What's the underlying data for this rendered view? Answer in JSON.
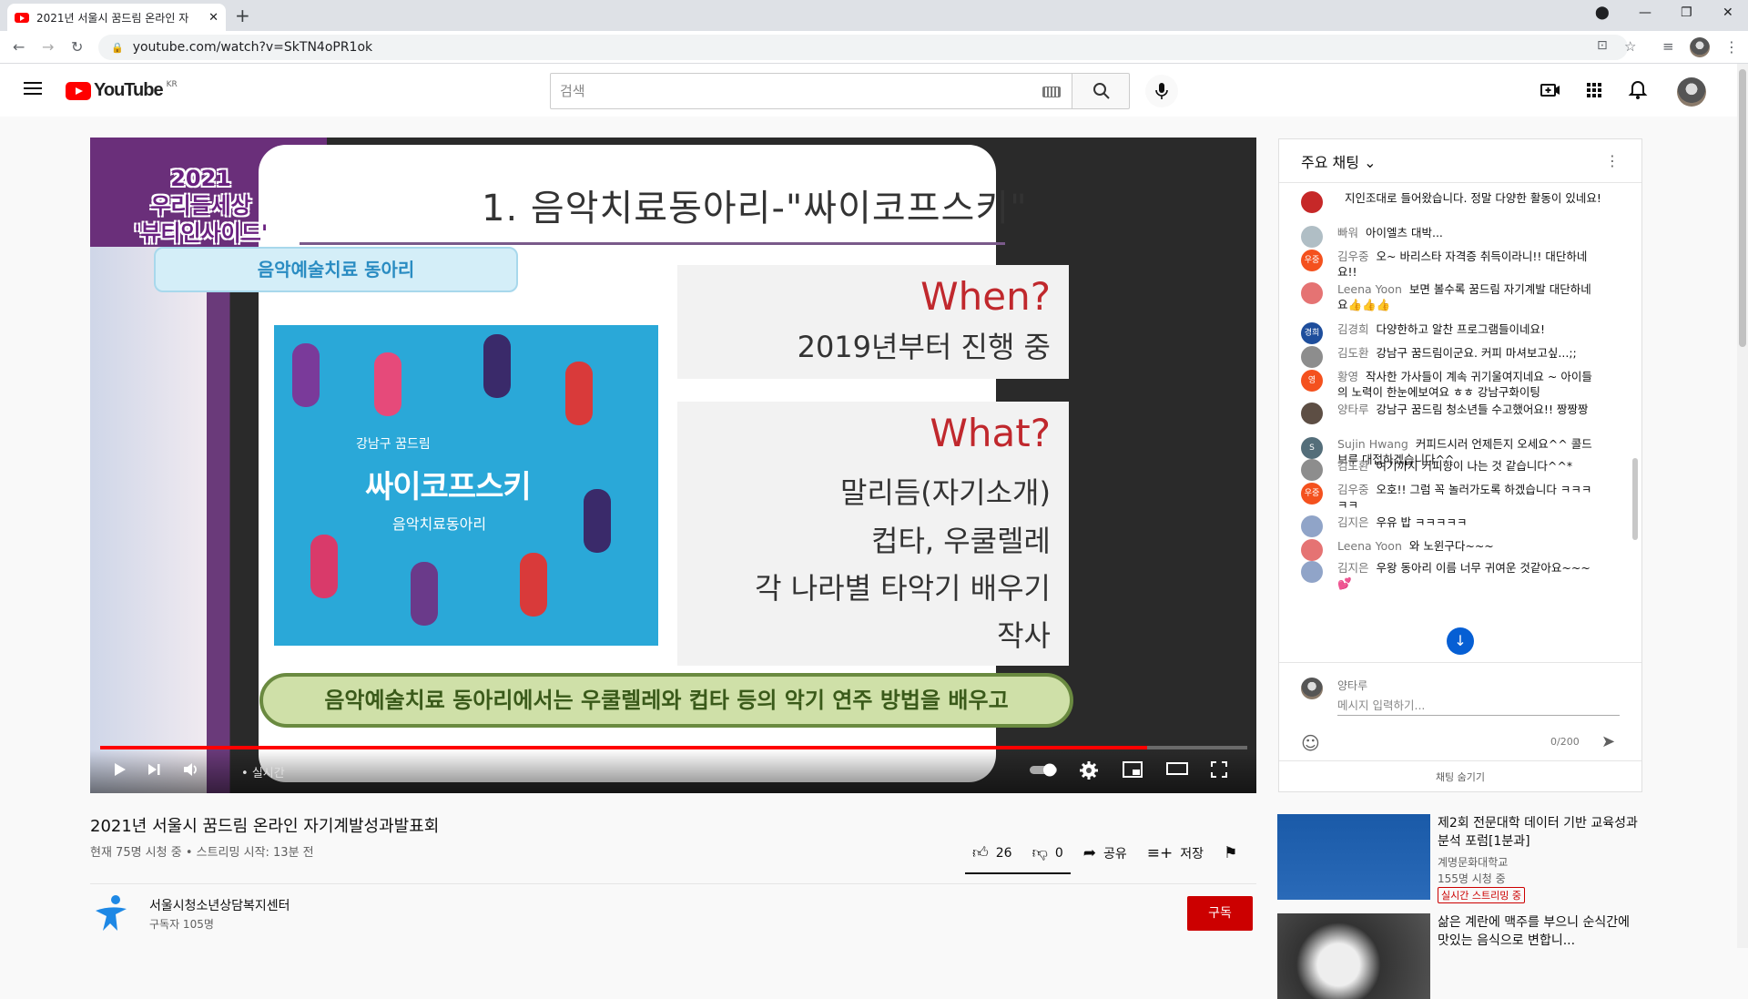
{
  "browser": {
    "tab_title": "2021년 서울시 꿈드림 온라인 자",
    "url": "youtube.com/watch?v=SkTN4oPR1ok"
  },
  "youtube": {
    "logo_text": "YouTube",
    "region": "KR",
    "search_placeholder": "검색"
  },
  "video": {
    "title": "2021년 서울시 꿈드림 온라인 자기계발성과발표회",
    "meta": "현재 75명 시청 중 • 스트리밍 시작: 13분 전",
    "live_label": "실시간",
    "progress_fraction": 0.913,
    "slide": {
      "year_text": "2021",
      "year_sub1": "우리들세상",
      "year_sub2": "'뷰티인사이드'",
      "title": "1. 음악치료동아리-\"싸이코프스키\"",
      "club_badge": "음악예술치료 동아리",
      "when_label": "When?",
      "when_text": "2019년부터 진행 중",
      "what_label": "What?",
      "what_items": [
        "말리듬(자기소개)",
        "컵타, 우쿨렐레",
        "각 나라별 타악기 배우기",
        "작사"
      ],
      "poster_small": "강남구 꿈드림",
      "poster_big": "싸이코프스키",
      "poster_sub": "음악치료동아리",
      "caption": "음악예술치료 동아리에서는 우쿨렐레와 컵타 등의 악기 연주 방법을 배우고"
    },
    "actions": {
      "like_count": "26",
      "dislike_count": "0",
      "share_label": "공유",
      "save_label": "저장"
    },
    "channel": {
      "name": "서울시청소년상담복지센터",
      "subscribers": "구독자 105명",
      "subscribe_label": "구독"
    }
  },
  "chat": {
    "header": "주요 채팅",
    "messages": [
      {
        "author": "",
        "text": "지인조대로 들어왔습니다. 정말 다양한 활동이 있네요!",
        "avatar_color": "#c62828",
        "avatar_text": ""
      },
      {
        "author": "빠워",
        "text": "아이엘츠 대박...",
        "avatar_color": "#b0bec5",
        "avatar_text": ""
      },
      {
        "author": "김우중",
        "text": "오~ 바리스타 자격증 취득이라니!! 대단하네요!!",
        "avatar_color": "#f4511e",
        "avatar_text": "우중"
      },
      {
        "author": "Leena Yoon",
        "text": "보면 볼수록 꿈드림 자기계발 대단하네요👍👍👍",
        "avatar_color": "#e57373",
        "avatar_text": ""
      },
      {
        "author": "김경희",
        "text": "다양한하고 알찬 프로그램들이네요!",
        "avatar_color": "#1e4e9c",
        "avatar_text": "경희"
      },
      {
        "author": "김도환",
        "text": "강남구 꿈드림이군요. 커피 마셔보고싶...;;",
        "avatar_color": "#8d8d8d",
        "avatar_text": ""
      },
      {
        "author": "황영",
        "text": "작사한 가사들이 계속 귀기울여지네요 ~ 아이들의 노력이 한눈에보여요 ㅎㅎ 강남구화이팅",
        "avatar_color": "#f4511e",
        "avatar_text": "영"
      },
      {
        "author": "양타루",
        "text": "강남구 꿈드림 청소년들 수고했어요!! 짱짱짱",
        "avatar_color": "#5d4e44",
        "avatar_text": ""
      },
      {
        "author": "Sujin Hwang",
        "text": "커피드시러 언제든지 오세요^^ 콜드브루 대접하겠습니다^^",
        "avatar_color": "#546e7a",
        "avatar_text": "S"
      },
      {
        "author": "김도환",
        "text": "여기까지 커피향이 나는 것 같습니다^^*",
        "avatar_color": "#8d8d8d",
        "avatar_text": ""
      },
      {
        "author": "김우중",
        "text": "오호!! 그럼 꼭 놀러가도록 하겠습니다 ㅋㅋㅋㅋㅋ",
        "avatar_color": "#f4511e",
        "avatar_text": "우중"
      },
      {
        "author": "김지은",
        "text": "우유 밥 ㅋㅋㅋㅋㅋ",
        "avatar_color": "#90a4c8",
        "avatar_text": ""
      },
      {
        "author": "Leena Yoon",
        "text": "와 노윈구다~~~",
        "avatar_color": "#e57373",
        "avatar_text": ""
      },
      {
        "author": "김지은",
        "text": "우왕 동아리 이름 너무 귀여운 것같아요~~~💕",
        "avatar_color": "#90a4c8",
        "avatar_text": ""
      }
    ],
    "my_name": "양타루",
    "input_placeholder": "메시지 입력하기...",
    "counter": "0/200",
    "hide_label": "채팅 숨기기"
  },
  "recommendations": [
    {
      "title": "제2회 전문대학 데이터 기반 교육성과 분석 포럼[1분과]",
      "channel": "계명문화대학교",
      "viewers": "155명 시청 중",
      "badge": "실시간 스트리밍 중"
    },
    {
      "title": "삶은 계란에 맥주를 부으니 순식간에 맛있는 음식으로 변합니...",
      "channel": "",
      "viewers": "",
      "badge": ""
    }
  ]
}
